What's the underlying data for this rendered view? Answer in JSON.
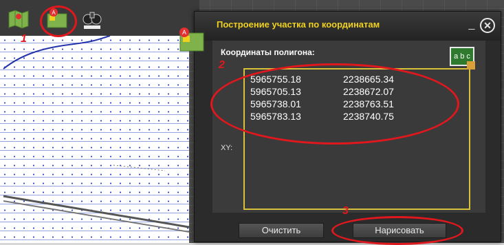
{
  "toolbar": {
    "icons": [
      "map-icon",
      "plot-by-coordinates-icon",
      "binoculars-icon"
    ]
  },
  "annotations": {
    "num1": "1",
    "num2": "2",
    "num3": "3",
    "color": "#e0181e"
  },
  "dialog": {
    "title": "Построение участка по координатам",
    "minimize": "_",
    "close": "✕",
    "coords_label": "Координаты полигона:",
    "xy_label": "XY:",
    "coordinates": [
      {
        "x": "5965755.18",
        "y": "2238665.34"
      },
      {
        "x": "5965705.13",
        "y": "2238672.07"
      },
      {
        "x": "5965738.01",
        "y": "2238763.51"
      },
      {
        "x": "5965783.13",
        "y": "2238740.75"
      }
    ],
    "clear_button": "Очистить",
    "draw_button": "Нарисовать",
    "title_color": "#f0d21e",
    "border_color": "#d8c23a"
  }
}
